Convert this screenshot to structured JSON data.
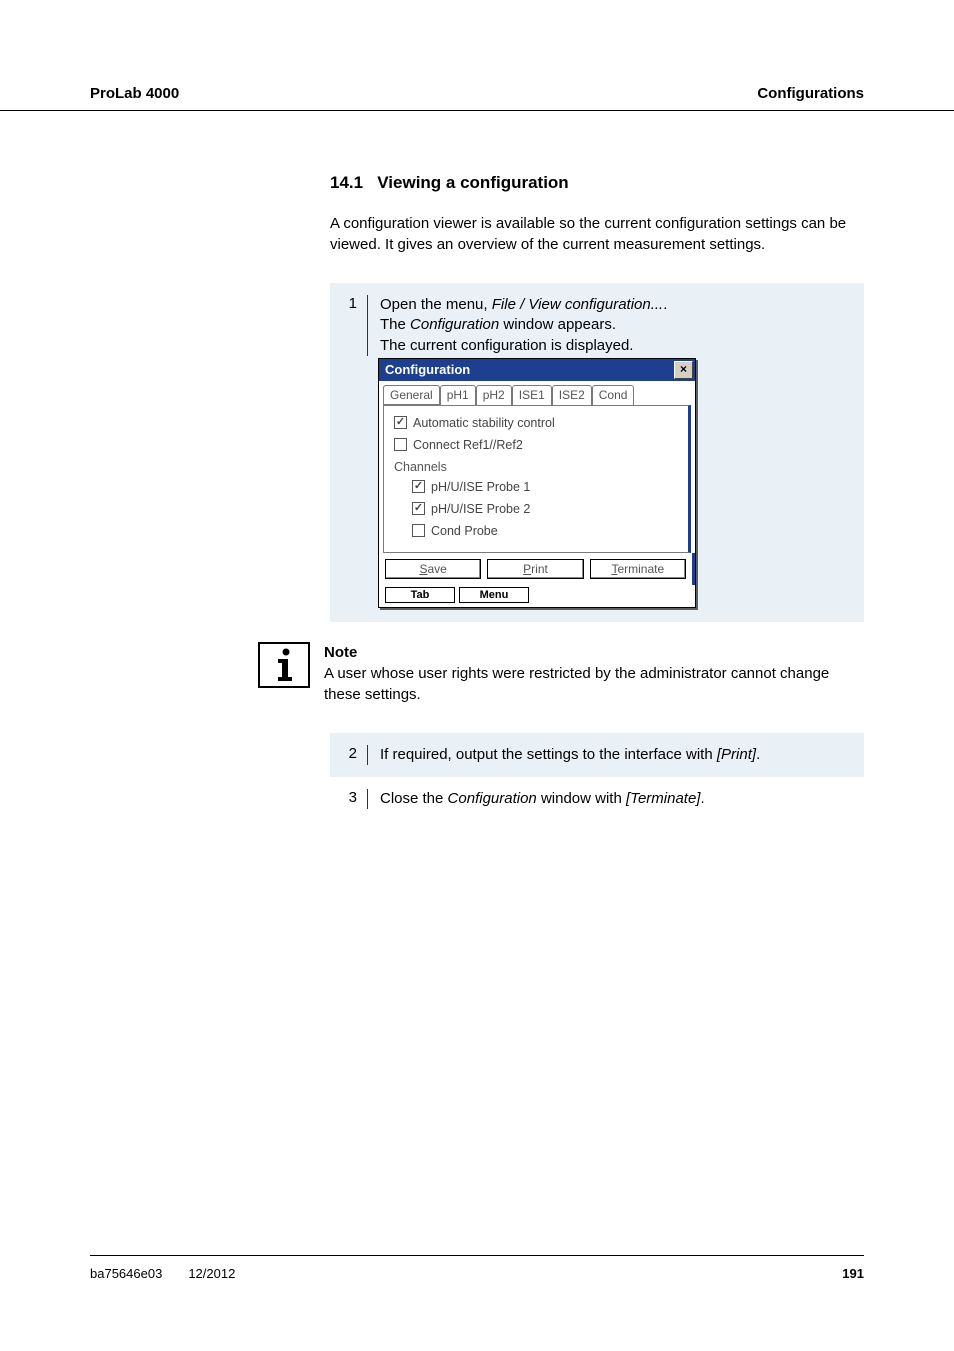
{
  "header": {
    "left": "ProLab 4000",
    "right": "Configurations"
  },
  "section": {
    "number": "14.1",
    "title": "Viewing a configuration"
  },
  "intro": "A configuration viewer is available so the current configuration settings can be viewed. It gives an overview of the current measurement settings.",
  "steps": {
    "s1": {
      "num": "1",
      "line1_pre": "Open the menu, ",
      "line1_italic": "File  /  View configuration...",
      "line1_post": ".",
      "line2_pre": "The ",
      "line2_italic": "Configuration",
      "line2_post": " window appears.",
      "line3": "The current configuration is displayed."
    },
    "s2": {
      "num": "2",
      "text_pre": "If required, output the settings to the interface with ",
      "text_italic": "[Print]",
      "text_post": "."
    },
    "s3": {
      "num": "3",
      "text_pre": "Close the ",
      "text_italic1": "Configuration",
      "text_mid": " window with ",
      "text_italic2": "[Terminate]",
      "text_post": "."
    }
  },
  "config_window": {
    "title": "Configuration",
    "close": "×",
    "tabs": [
      "General",
      "pH1",
      "pH2",
      "ISE1",
      "ISE2",
      "Cond"
    ],
    "cb_auto": "Automatic stability control",
    "cb_connect": "Connect Ref1//Ref2",
    "group_channels": "Channels",
    "cb_probe1": "pH/U/ISE Probe 1",
    "cb_probe2": "pH/U/ISE Probe 2",
    "cb_cond": "Cond Probe",
    "btn_save_u": "S",
    "btn_save_rest": "ave",
    "btn_print_u": "P",
    "btn_print_rest": "rint",
    "btn_terminate_u": "T",
    "btn_terminate_rest": "erminate",
    "btn_tab": "Tab",
    "btn_menu": "Menu"
  },
  "note": {
    "label": "Note",
    "text": "A user whose user rights were restricted by the administrator cannot change these settings."
  },
  "footer": {
    "id": "ba75646e03",
    "date": "12/2012",
    "page": "191"
  }
}
